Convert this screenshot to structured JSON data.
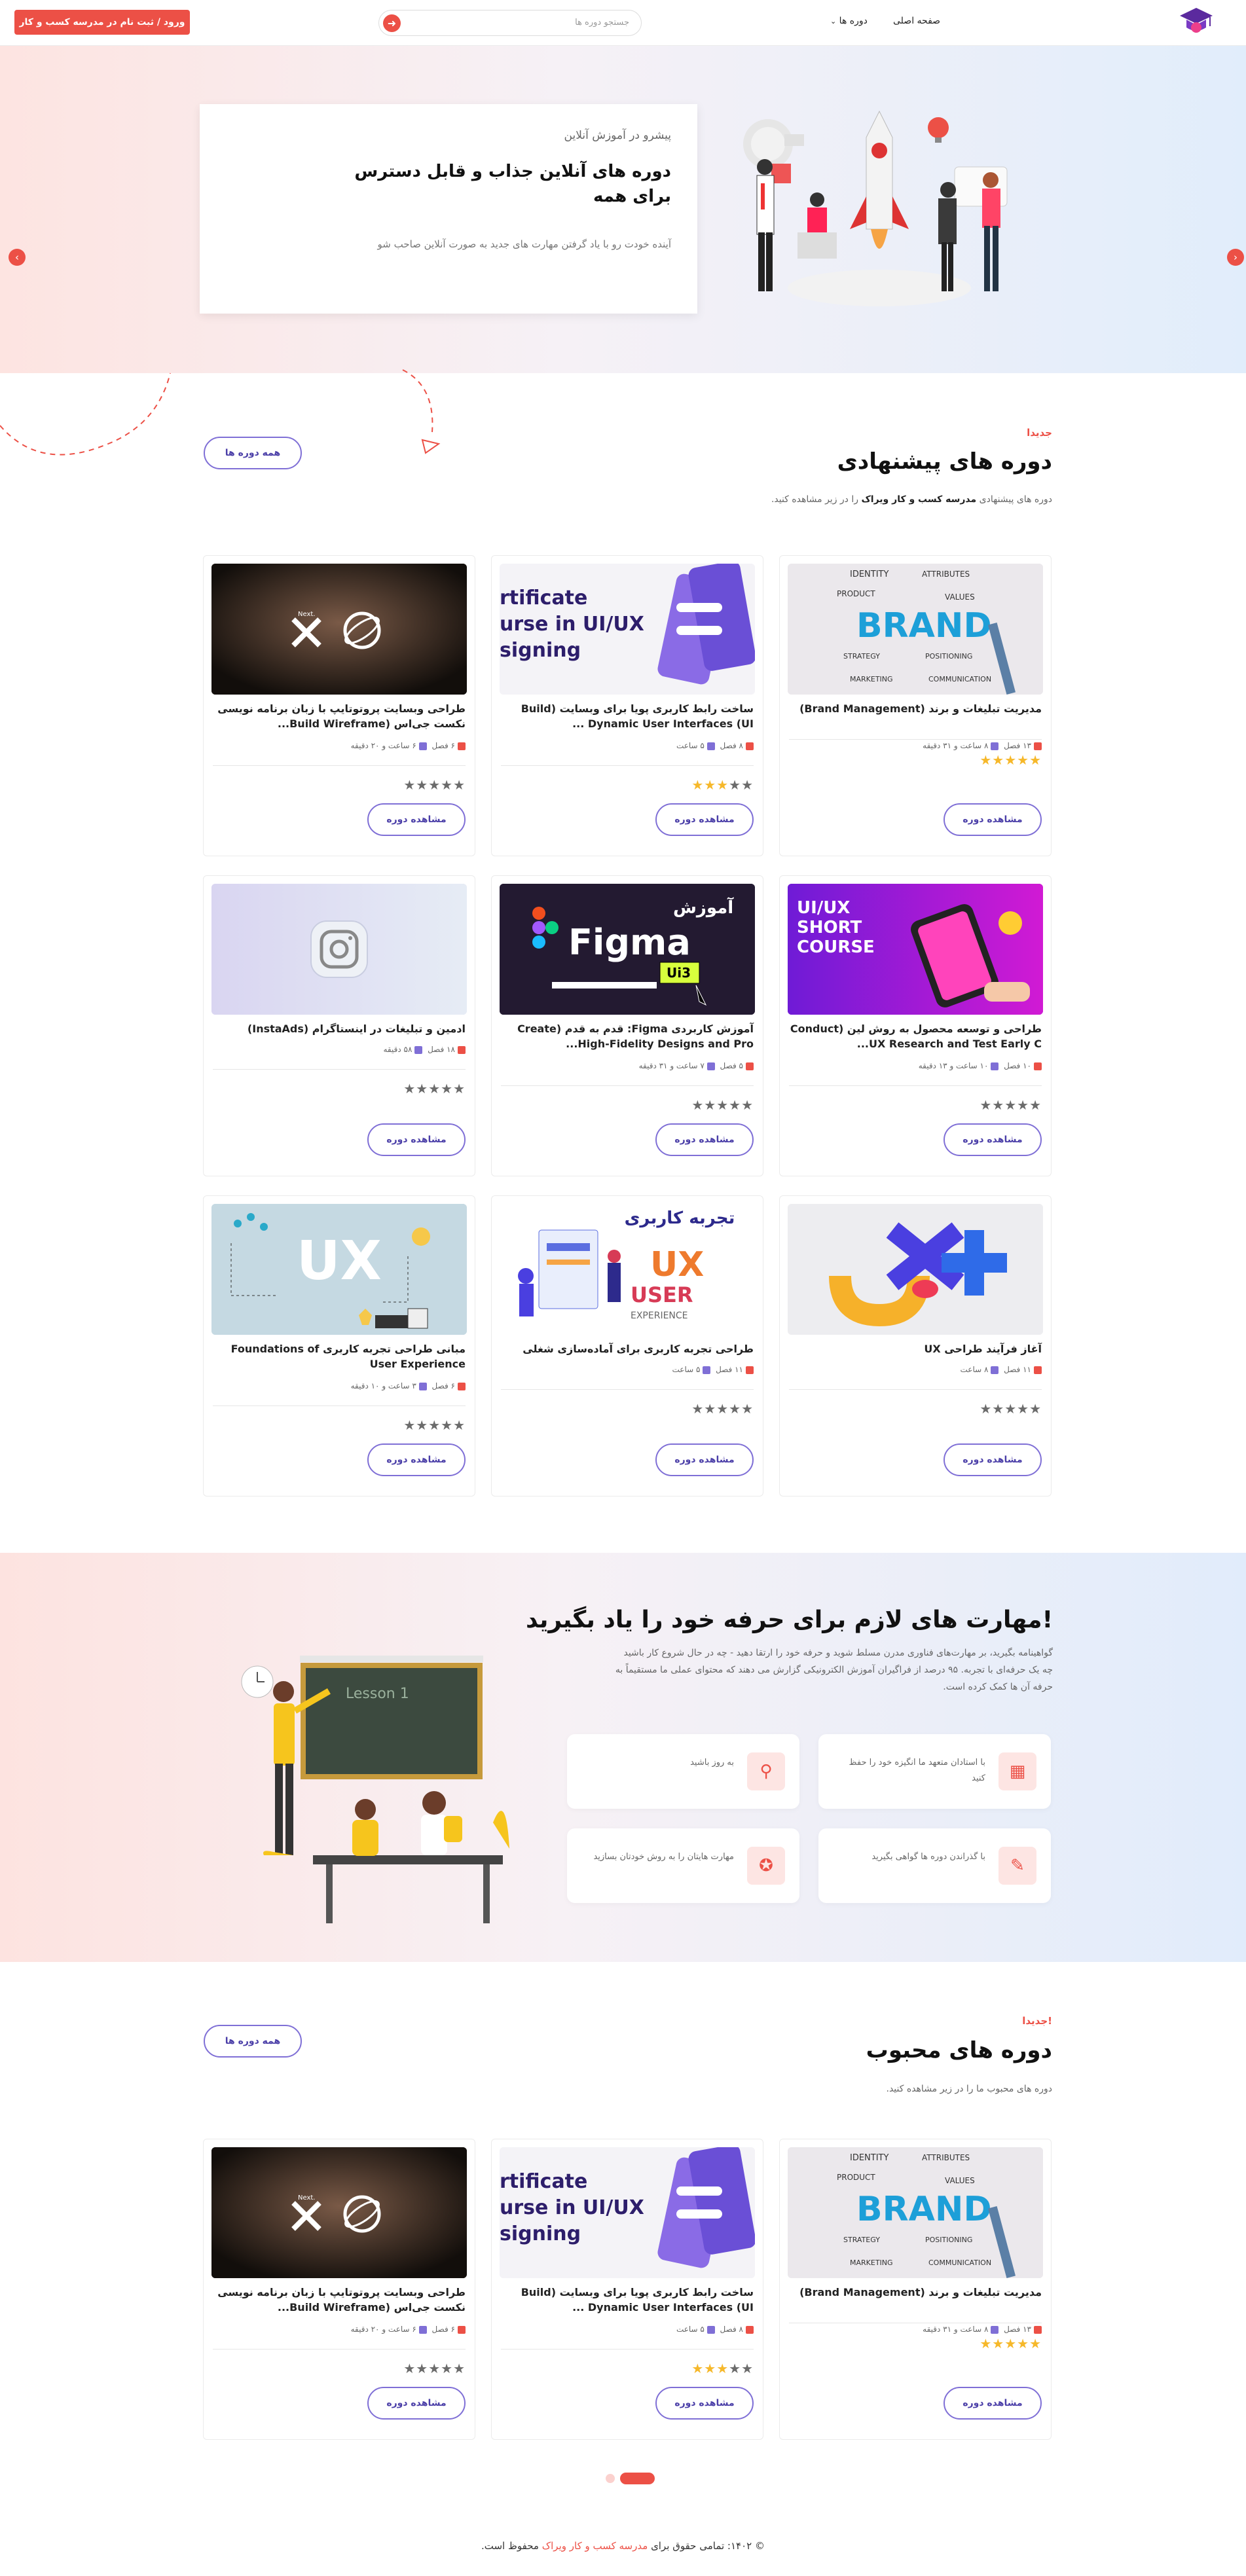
{
  "header": {
    "login_label": "ورود / ثبت نام در مدرسه کسب و کار",
    "search_placeholder": "جستجو دوره ها",
    "nav_courses": "دوره ها",
    "nav_home": "صفحه اصلی"
  },
  "hero": {
    "subtitle": "پیشرو در آموزش آنلاین",
    "title": "دوره های آنلاین جذاب و قابل دسترس برای همه",
    "description": "آینده خودت رو با یاد گرفتن مهارت های جدید به صورت آنلاین صاحب شو"
  },
  "recommended": {
    "tag": "جدیدا",
    "title": "دوره های پیشنهادی",
    "desc_prefix": "دوره های پیشنهادی",
    "desc_brand": "مدرسه کسب و کار ویراک",
    "desc_suffix": "را در زیر مشاهده کنید.",
    "all_button": "همه دوره ها"
  },
  "cards": [
    {
      "title": "مدیریت تبلیغات و برند (Brand Management)",
      "chapters": "۱۳ فصل",
      "duration": "۸ ساعت و ۳۱ دقیقه",
      "rating": 5,
      "button": "مشاهده دوره"
    },
    {
      "title": "ساخت رابط کاربری پویا برای وبسایت (Build Dynamic User Interfaces (UI ...",
      "chapters": "۸ فصل",
      "duration": "۵ ساعت",
      "rating": 3,
      "button": "مشاهده دوره"
    },
    {
      "title": "طراحی وبسایت پروتوتایپ با زبان برنامه نویسی نکست جی‌اس (Build Wireframe...",
      "chapters": "۶ فصل",
      "duration": "۶ ساعت و ۲۰ دقیقه",
      "rating": 0,
      "button": "مشاهده دوره"
    },
    {
      "title": "طراحی و توسعه محصول به روش لین (Conduct UX Research and Test Early C...",
      "chapters": "۱۰ فصل",
      "duration": "۱۰ ساعت و ۱۳ دقیقه",
      "rating": 0,
      "button": "مشاهده دوره"
    },
    {
      "title": "آموزش کاربردی Figma: قدم به قدم (Create High-Fidelity Designs and Pro...",
      "chapters": "۵ فصل",
      "duration": "۷ ساعت و ۳۱ دقیقه",
      "rating": 0,
      "button": "مشاهده دوره"
    },
    {
      "title": "ادمین و تبلیغات در اینستاگرام (InstaAds)",
      "chapters": "۱۸ فصل",
      "duration": "۵۸ دقیقه",
      "rating": 0,
      "button": "مشاهده دوره"
    },
    {
      "title": "آغاز فرآیند طراحی UX",
      "chapters": "۱۱ فصل",
      "duration": "۸ ساعت",
      "rating": 0,
      "button": "مشاهده دوره"
    },
    {
      "title": "طراحی تجربه کاربری برای آماده‌سازی شغلی",
      "chapters": "۱۱ فصل",
      "duration": "۵ ساعت",
      "rating": 0,
      "button": "مشاهده دوره"
    },
    {
      "title": "مبانی طراحی تجربه کاربری Foundations of User Experience",
      "chapters": "۶ فصل",
      "duration": "۳ ساعت و ۱۰ دقیقه",
      "rating": 0,
      "button": "مشاهده دوره"
    }
  ],
  "skills": {
    "title": "مهارت های لازم برای حرفه خود را یاد بگیرید!",
    "description": "گواهینامه بگیرید، بر مهارت‌های فناوری مدرن مسلط شوید و حرفه خود را ارتقا دهید - چه در حال شروع کار باشید چه یک حرفه‌ای با تجربه. ۹۵ درصد از فراگیران آموزش الکترونیکی گزارش می دهند که محتوای عملی ما مستقیماً به حرفه آن ها کمک کرده است.",
    "features": [
      {
        "text": "با استادان متعهد ما انگیزه خود را حفظ کنید",
        "icon": "books-icon"
      },
      {
        "text": "به روز باشید",
        "icon": "teacher-icon"
      },
      {
        "text": "با گذراندن دوره ها گواهی بگیرید",
        "icon": "certificate-icon"
      },
      {
        "text": "مهارت هایتان را به روش خودتان بسازید",
        "icon": "badge-icon"
      }
    ],
    "board_text": "Lesson 1"
  },
  "popular": {
    "tag": "جدیدا!",
    "title": "دوره های محبوب",
    "desc_prefix": "دوره های محبوب ما را در زیر مشاهده کنید.",
    "all_button": "همه دوره ها"
  },
  "popular_cards": [
    {
      "title": "مدیریت تبلیغات و برند (Brand Management)",
      "chapters": "۱۳ فصل",
      "duration": "۸ ساعت و ۳۱ دقیقه",
      "rating": 5,
      "button": "مشاهده دوره"
    },
    {
      "title": "ساخت رابط کاربری پویا برای وبسایت (Build Dynamic User Interfaces (UI ...",
      "chapters": "۸ فصل",
      "duration": "۵ ساعت",
      "rating": 3,
      "button": "مشاهده دوره"
    },
    {
      "title": "طراحی وبسایت پروتوتایپ با زبان برنامه نویسی نکست جی‌اس (Build Wireframe...",
      "chapters": "۶ فصل",
      "duration": "۶ ساعت و ۲۰ دقیقه",
      "rating": 0,
      "button": "مشاهده دوره"
    }
  ],
  "image_text": {
    "brand_words": [
      "IDENTITY",
      "ATTRIBUTES",
      "PRODUCT",
      "VALUES",
      "BRAND",
      "STRATEGY",
      "POSITIONING",
      "MARKETING",
      "COMMUNICATION"
    ],
    "cert_lines": [
      "rtificate",
      "urse in UI/UX",
      "signing"
    ],
    "next_label": "Next.",
    "figma_head": "آموزش",
    "figma_word": "Figma",
    "figma_tag": "Ui3",
    "uiux_lines": [
      "UI/UX",
      "SHORT",
      "COURSE"
    ],
    "ux_big": "UX",
    "ux_user": "USER",
    "ux_exp": "EXPERIENCE",
    "ux_fa": "تجربه کاربری"
  },
  "footer": {
    "prefix": "© ۱۴۰۲: تمامی حقوق برای",
    "brand": "مدرسه کسب و کار ویراک",
    "suffix": "محفوظ است."
  },
  "colors": {
    "accent": "#ec5046",
    "button_border": "#7f6fd6",
    "star": "#f6b82a"
  }
}
